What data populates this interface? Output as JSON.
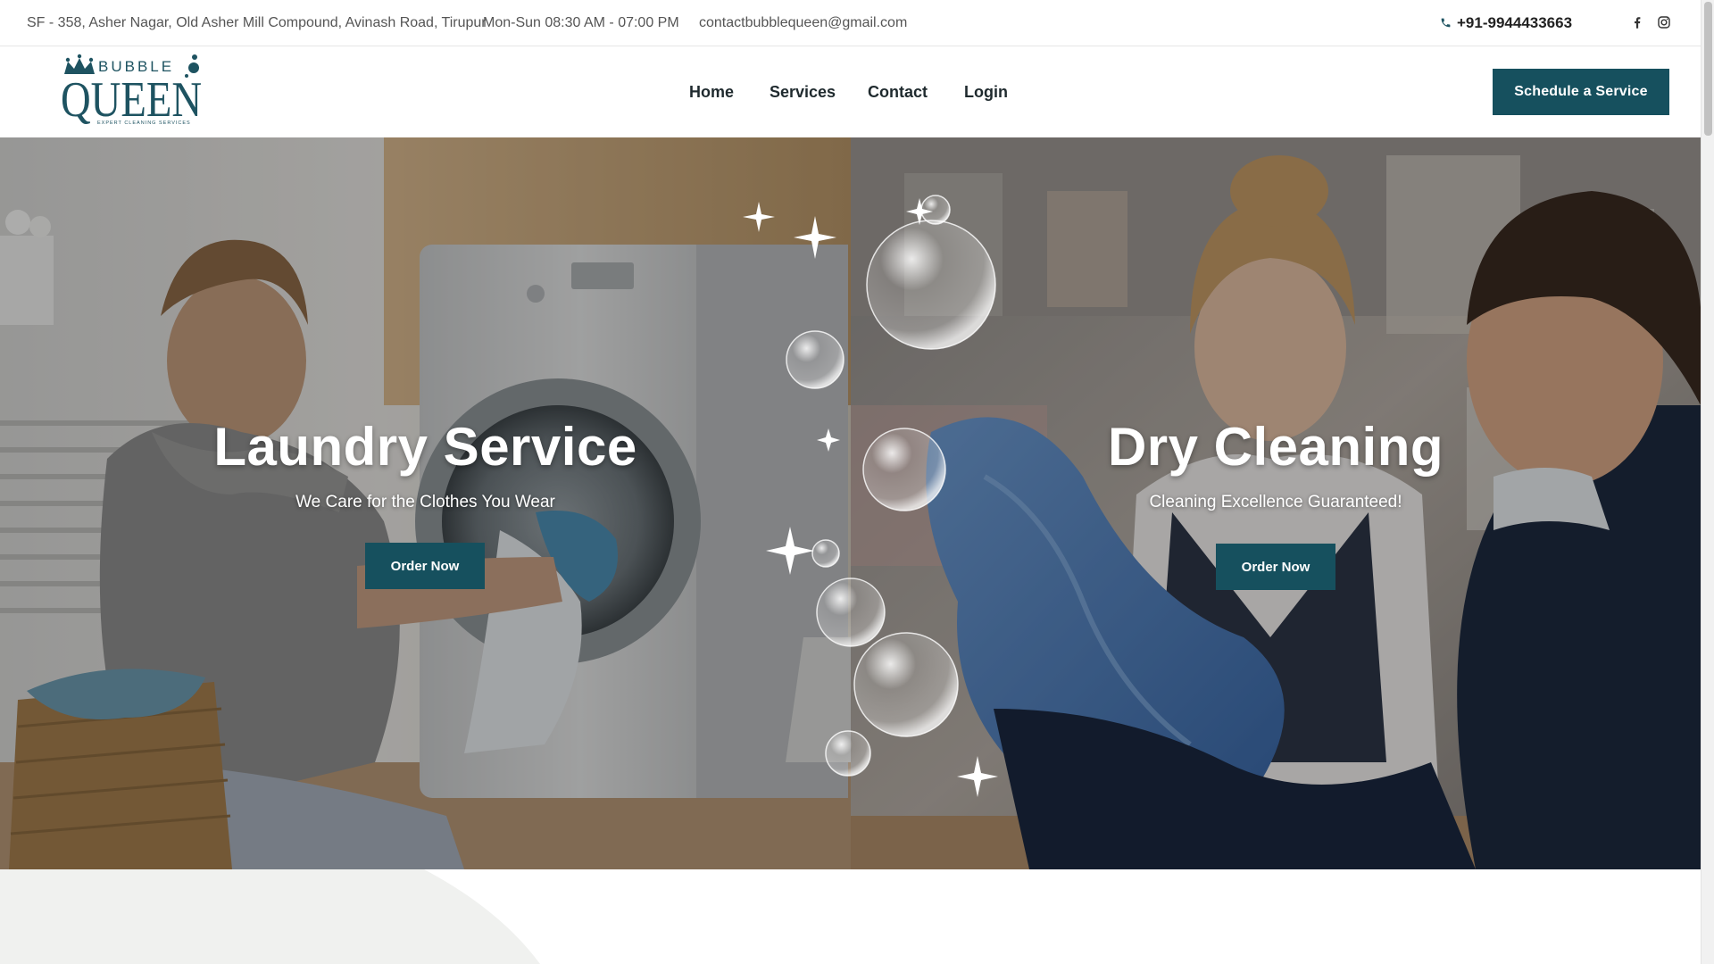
{
  "topbar": {
    "address": "SF - 358, Asher Nagar, Old Asher Mill Compound, Avinash Road, Tirupur",
    "hours": "Mon-Sun 08:30 AM - 07:00 PM",
    "email": "contactbubblequeen@gmail.com",
    "phone": "+91-9944433663",
    "icons": [
      "phone-icon",
      "facebook-icon",
      "instagram-icon"
    ]
  },
  "logo": {
    "top_word": "BUBBLE",
    "main_word": "QUEEN",
    "tagline": "EXPERT CLEANING SERVICES"
  },
  "nav": {
    "items": [
      {
        "label": "Home"
      },
      {
        "label": "Services"
      },
      {
        "label": "Contact"
      },
      {
        "label": "Login"
      }
    ],
    "cta_label": "Schedule a Service"
  },
  "hero": {
    "left": {
      "title": "Laundry Service",
      "subtitle": "We Care for the Clothes You Wear",
      "button": "Order Now"
    },
    "right": {
      "title": "Dry Cleaning",
      "subtitle": "Cleaning Excellence Guaranteed!",
      "button": "Order Now"
    }
  },
  "colors": {
    "accent": "#16505e",
    "logo": "#1e5361",
    "text_dark": "#1f2a2e",
    "section_bg": "#f0f1ef"
  }
}
